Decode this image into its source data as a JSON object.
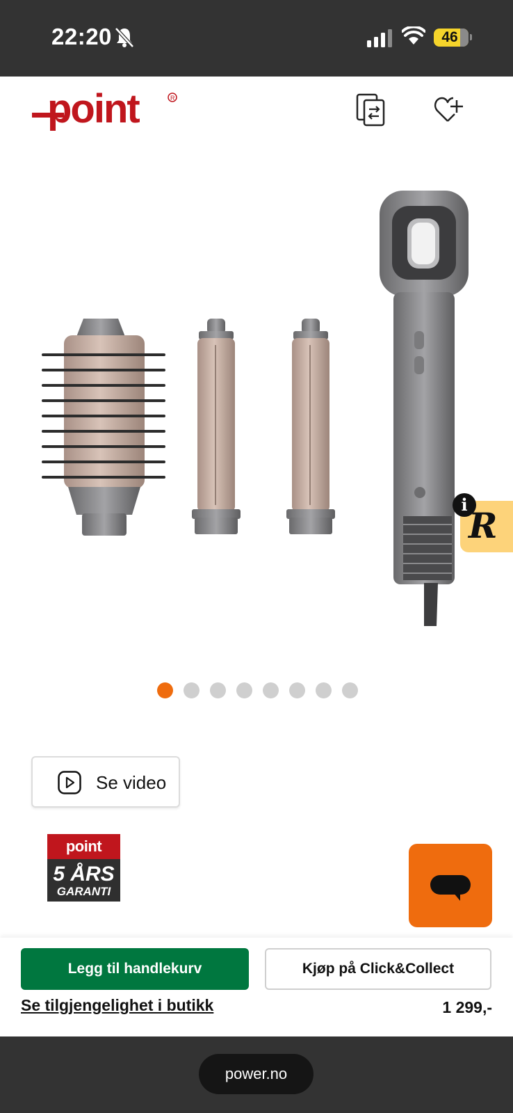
{
  "status_bar": {
    "time": "22:20",
    "battery": "46",
    "icons": [
      "bell-slash-icon",
      "cellular-signal-icon",
      "wifi-icon",
      "battery-icon"
    ]
  },
  "header": {
    "logo_text": "point",
    "logo_color": "#c0161d",
    "icons": [
      "compare-icon",
      "heart-plus-icon"
    ]
  },
  "gallery": {
    "image_description_icon": "hair-styler-product-photo",
    "dot_count": 8,
    "active_index": 0,
    "active_color": "#ef6c0e"
  },
  "video_button": {
    "label": "Se video"
  },
  "warranty": {
    "brand": "point",
    "line1": "5 ÅRS",
    "line2": "GARANTI"
  },
  "side_widget": {
    "letter": "R",
    "info": "i"
  },
  "actions": {
    "add_to_cart": "Legg til handlekurv",
    "click_collect": "Kjøp på Click&Collect",
    "availability": "Se tilgjengelighet i butikk",
    "price": "1 299,-",
    "add_to_cart_color": "#00773f"
  },
  "browser": {
    "url": "power.no"
  }
}
